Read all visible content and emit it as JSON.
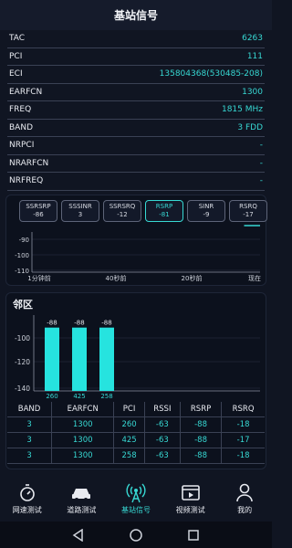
{
  "title": "基站信号",
  "info": [
    {
      "k": "TAC",
      "v": "6263"
    },
    {
      "k": "PCI",
      "v": "111"
    },
    {
      "k": "ECI",
      "v": "135804368(530485-208)"
    },
    {
      "k": "EARFCN",
      "v": "1300"
    },
    {
      "k": "FREQ",
      "v": "1815 MHz"
    },
    {
      "k": "BAND",
      "v": "3 FDD"
    },
    {
      "k": "NRPCI",
      "v": "-"
    },
    {
      "k": "NRARFCN",
      "v": "-"
    },
    {
      "k": "NRFREQ",
      "v": "-"
    },
    {
      "k": "NRBAND",
      "v": "-"
    }
  ],
  "signal_tabs": [
    {
      "name": "SSRSRP",
      "value": "-86"
    },
    {
      "name": "SSSINR",
      "value": "3"
    },
    {
      "name": "SSRSRQ",
      "value": "-12"
    },
    {
      "name": "RSRP",
      "value": "-81"
    },
    {
      "name": "SINR",
      "value": "-9"
    },
    {
      "name": "RSRQ",
      "value": "-17"
    }
  ],
  "active_tab": "RSRP",
  "accent_color": "#37d8d3",
  "chart_data": [
    {
      "type": "line",
      "title": "",
      "yticks": [
        "-90",
        "-100",
        "-110"
      ],
      "xticks": [
        "1分钟前",
        "40秒前",
        "20秒前",
        "现在"
      ],
      "ylim": [
        -110,
        -80
      ],
      "series": [
        {
          "color": "#37d8d3",
          "x": [
            0.93,
            1.0
          ],
          "values": [
            -84,
            -84
          ]
        }
      ]
    },
    {
      "type": "bar",
      "title": "邻区",
      "yticks": [
        "-100",
        "-120",
        "-140"
      ],
      "ylim": [
        -140,
        -80
      ],
      "categories": [
        "260",
        "425",
        "258"
      ],
      "values": [
        -88,
        -88,
        -88
      ],
      "value_labels": [
        "-88",
        "-88",
        "-88"
      ],
      "bar_color": "#26e3df"
    }
  ],
  "neighbor_table": {
    "headers": [
      "BAND",
      "EARFCN",
      "PCI",
      "RSSI",
      "RSRP",
      "RSRQ"
    ],
    "rows": [
      [
        "3",
        "1300",
        "260",
        "-63",
        "-88",
        "-18"
      ],
      [
        "3",
        "1300",
        "425",
        "-63",
        "-88",
        "-17"
      ],
      [
        "3",
        "1300",
        "258",
        "-63",
        "-88",
        "-18"
      ]
    ]
  },
  "bottom_nav": [
    {
      "label": "网速测试",
      "icon": "stopwatch-icon"
    },
    {
      "label": "道路测试",
      "icon": "car-icon"
    },
    {
      "label": "基站信号",
      "icon": "antenna-icon",
      "active": true
    },
    {
      "label": "视频测试",
      "icon": "video-icon"
    },
    {
      "label": "我的",
      "icon": "person-icon"
    }
  ],
  "system_nav": [
    "back-icon",
    "home-icon",
    "recents-icon"
  ]
}
